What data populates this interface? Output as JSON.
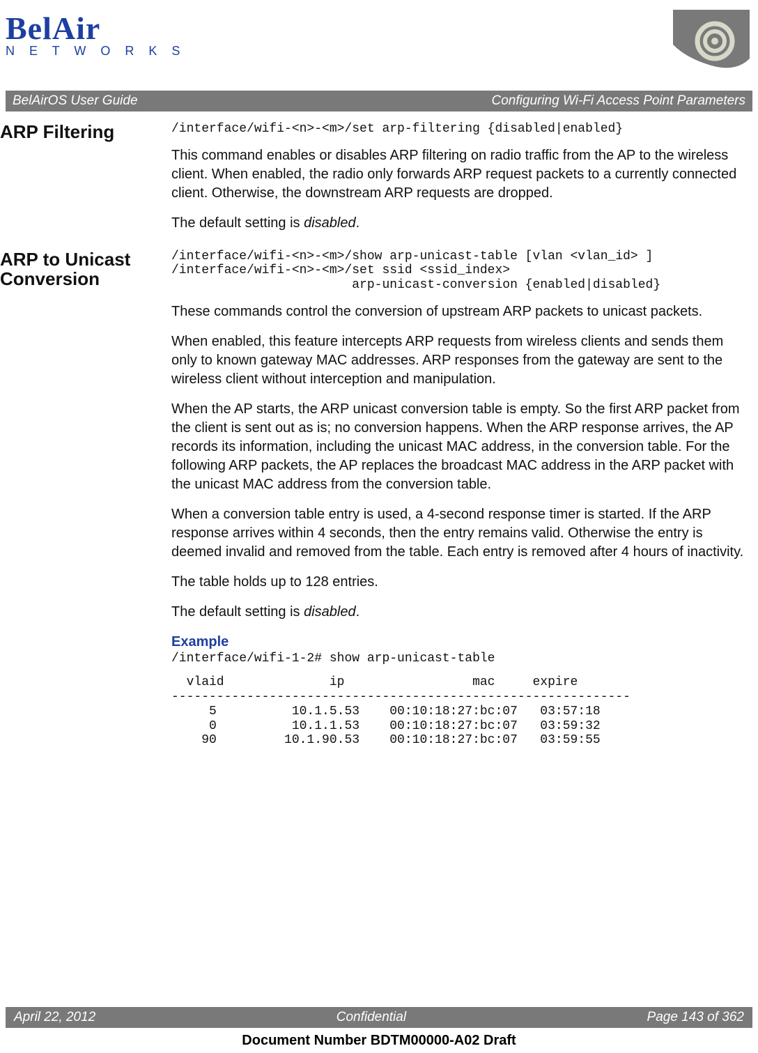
{
  "logo": {
    "brand_top": "BelAir",
    "brand_bottom": "N E T W O R K S"
  },
  "title_bar": {
    "left": "BelAirOS User Guide",
    "right": "Configuring Wi-Fi Access Point Parameters"
  },
  "section1": {
    "heading": "ARP Filtering",
    "cmd": "/interface/wifi-<n>-<m>/set arp-filtering {disabled|enabled}",
    "para1": "This command enables or disables ARP filtering on radio traffic from the AP to the wireless client. When enabled, the radio only forwards ARP request packets to a currently connected client. Otherwise, the downstream ARP requests are dropped.",
    "para2a": "The default setting is ",
    "para2b": "disabled",
    "para2c": "."
  },
  "section2": {
    "heading": "ARP to Unicast Conversion",
    "cmd": "/interface/wifi-<n>-<m>/show arp-unicast-table [vlan <vlan_id> ]\n/interface/wifi-<n>-<m>/set ssid <ssid_index>\n                        arp-unicast-conversion {enabled|disabled}",
    "para1": "These commands control the conversion of upstream ARP packets to unicast packets.",
    "para2": "When enabled, this feature intercepts ARP requests from wireless clients and sends them only to known gateway MAC addresses. ARP responses from the gateway are sent to the wireless client without interception and manipulation.",
    "para3": "When the AP starts, the ARP unicast conversion table is empty. So the first ARP packet from the client is sent out as is; no conversion happens. When the ARP response arrives, the AP records its information, including the unicast MAC address, in the conversion table. For the following ARP packets, the AP replaces the broadcast MAC address in the ARP packet with the unicast MAC address from the conversion table.",
    "para4": "When a conversion table entry is used, a 4-second response timer is started. If the ARP response arrives within 4 seconds, then the entry remains valid. Otherwise the entry is deemed invalid and removed from the table. Each entry is removed after 4 hours of inactivity.",
    "para5": "The table holds up to 128 entries.",
    "para6a": "The default setting is ",
    "para6b": "disabled",
    "para6c": ".",
    "example_label": "Example",
    "example_cmd": "/interface/wifi-1-2# show arp-unicast-table",
    "example_table": "  vlaid              ip                 mac     expire\n-------------------------------------------------------------\n     5          10.1.5.53    00:10:18:27:bc:07   03:57:18\n     0          10.1.1.53    00:10:18:27:bc:07   03:59:32\n    90         10.1.90.53    00:10:18:27:bc:07   03:59:55"
  },
  "footer": {
    "date": "April 22, 2012",
    "center": "Confidential",
    "page": "Page 143 of 362"
  },
  "doc_number": "Document Number BDTM00000-A02 Draft"
}
